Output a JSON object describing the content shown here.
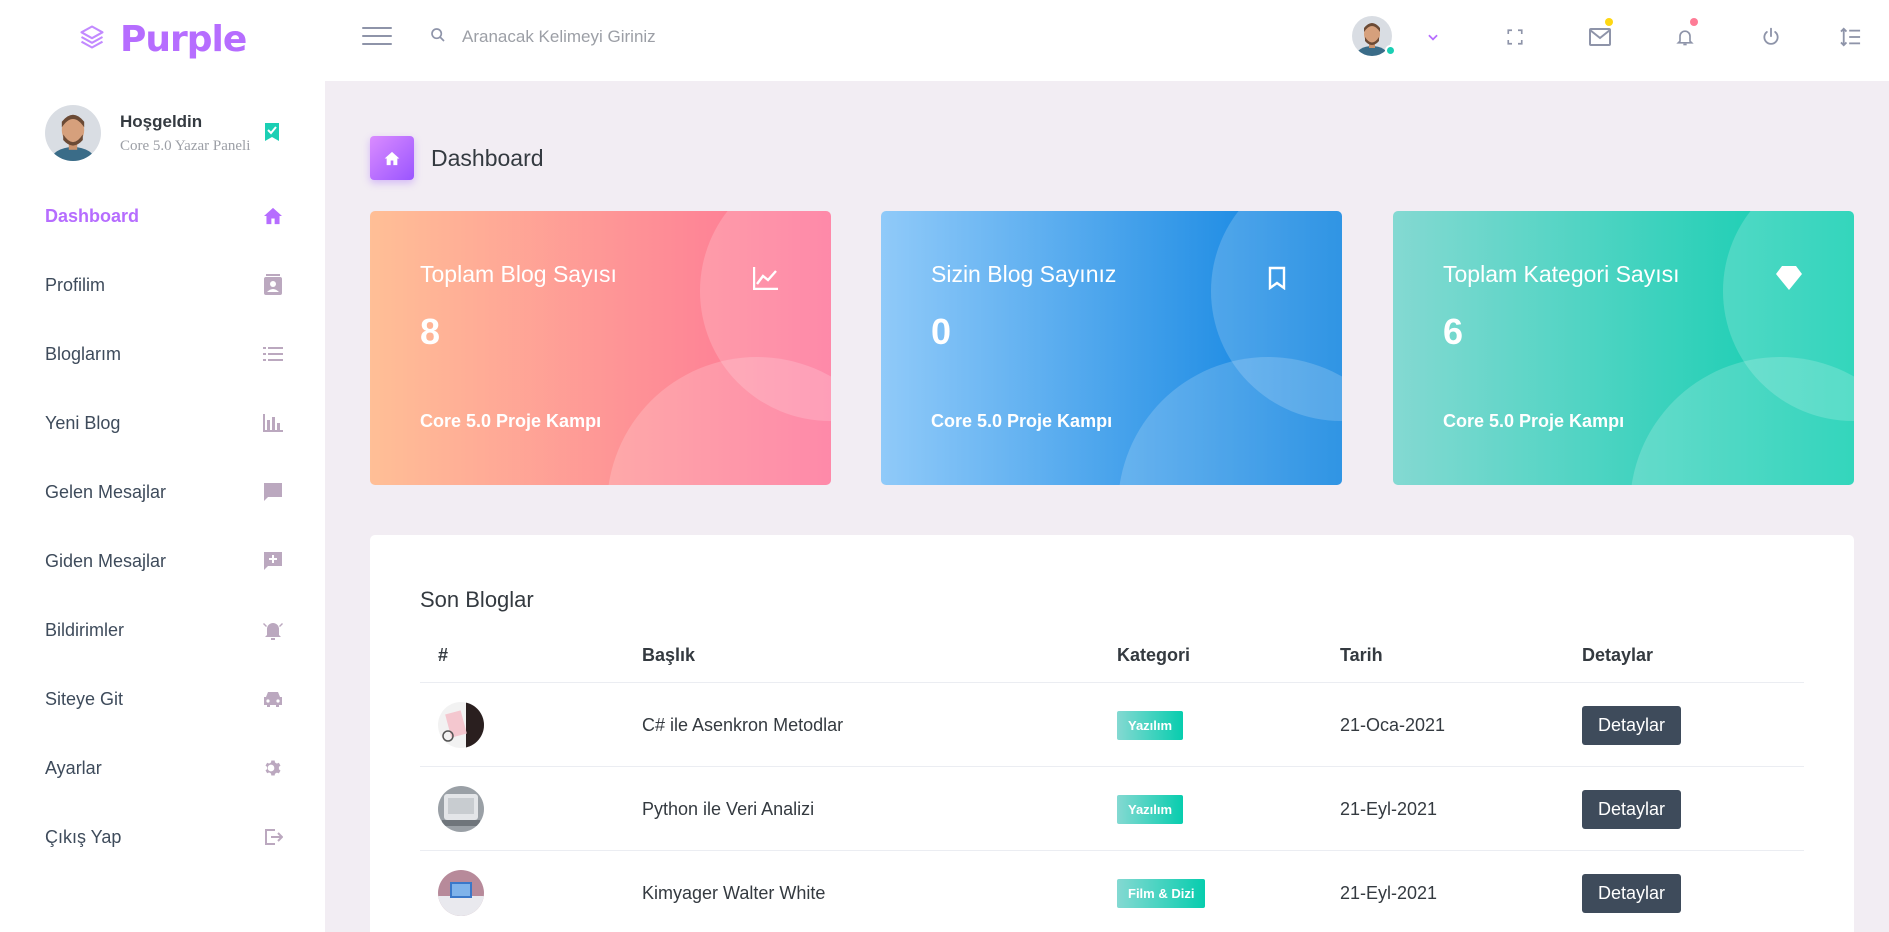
{
  "navbar": {
    "brand": "Purple",
    "search_placeholder": "Aranacak Kelimeyi Giriniz"
  },
  "sidebar": {
    "profile": {
      "name": "Hoşgeldin",
      "subtitle": "Core 5.0 Yazar Paneli"
    },
    "items": [
      {
        "label": "Dashboard",
        "icon": "home-icon",
        "active": true
      },
      {
        "label": "Profilim",
        "icon": "contact-card-icon"
      },
      {
        "label": "Bloglarım",
        "icon": "list-icon"
      },
      {
        "label": "Yeni Blog",
        "icon": "bar-chart-icon"
      },
      {
        "label": "Gelen Mesajlar",
        "icon": "message-icon"
      },
      {
        "label": "Giden Mesajlar",
        "icon": "message-plus-icon"
      },
      {
        "label": "Bildirimler",
        "icon": "alarm-bell-icon"
      },
      {
        "label": "Siteye Git",
        "icon": "car-icon"
      },
      {
        "label": "Ayarlar",
        "icon": "gear-icon"
      },
      {
        "label": "Çıkış Yap",
        "icon": "logout-icon"
      }
    ]
  },
  "page": {
    "title": "Dashboard"
  },
  "cards": [
    {
      "title": "Toplam Blog Sayısı",
      "value": "8",
      "footer": "Core 5.0 Proje Kampı",
      "icon": "chart-line-icon"
    },
    {
      "title": "Sizin Blog Sayınız",
      "value": "0",
      "footer": "Core 5.0 Proje Kampı",
      "icon": "bookmark-icon"
    },
    {
      "title": "Toplam Kategori Sayısı",
      "value": "6",
      "footer": "Core 5.0 Proje Kampı",
      "icon": "diamond-icon"
    }
  ],
  "recent": {
    "title": "Son Bloglar",
    "headers": [
      "#",
      "Başlık",
      "Kategori",
      "Tarih",
      "Detaylar"
    ],
    "rows": [
      {
        "title": "C# ile Asenkron Metodlar",
        "category": "Yazılım",
        "date": "21-Oca-2021",
        "action": "Detaylar"
      },
      {
        "title": "Python ile Veri Analizi",
        "category": "Yazılım",
        "date": "21-Eyl-2021",
        "action": "Detaylar"
      },
      {
        "title": "Kimyager Walter White",
        "category": "Film & Dizi",
        "date": "21-Eyl-2021",
        "action": "Detaylar"
      }
    ]
  },
  "colors": {
    "accent": "#b66dff",
    "sidebar_icon": "#bba8bff5",
    "dark_button": "#3e4b5b",
    "teal": "#1bcfb4",
    "warning": "#fed713",
    "danger": "#fe7c96"
  }
}
